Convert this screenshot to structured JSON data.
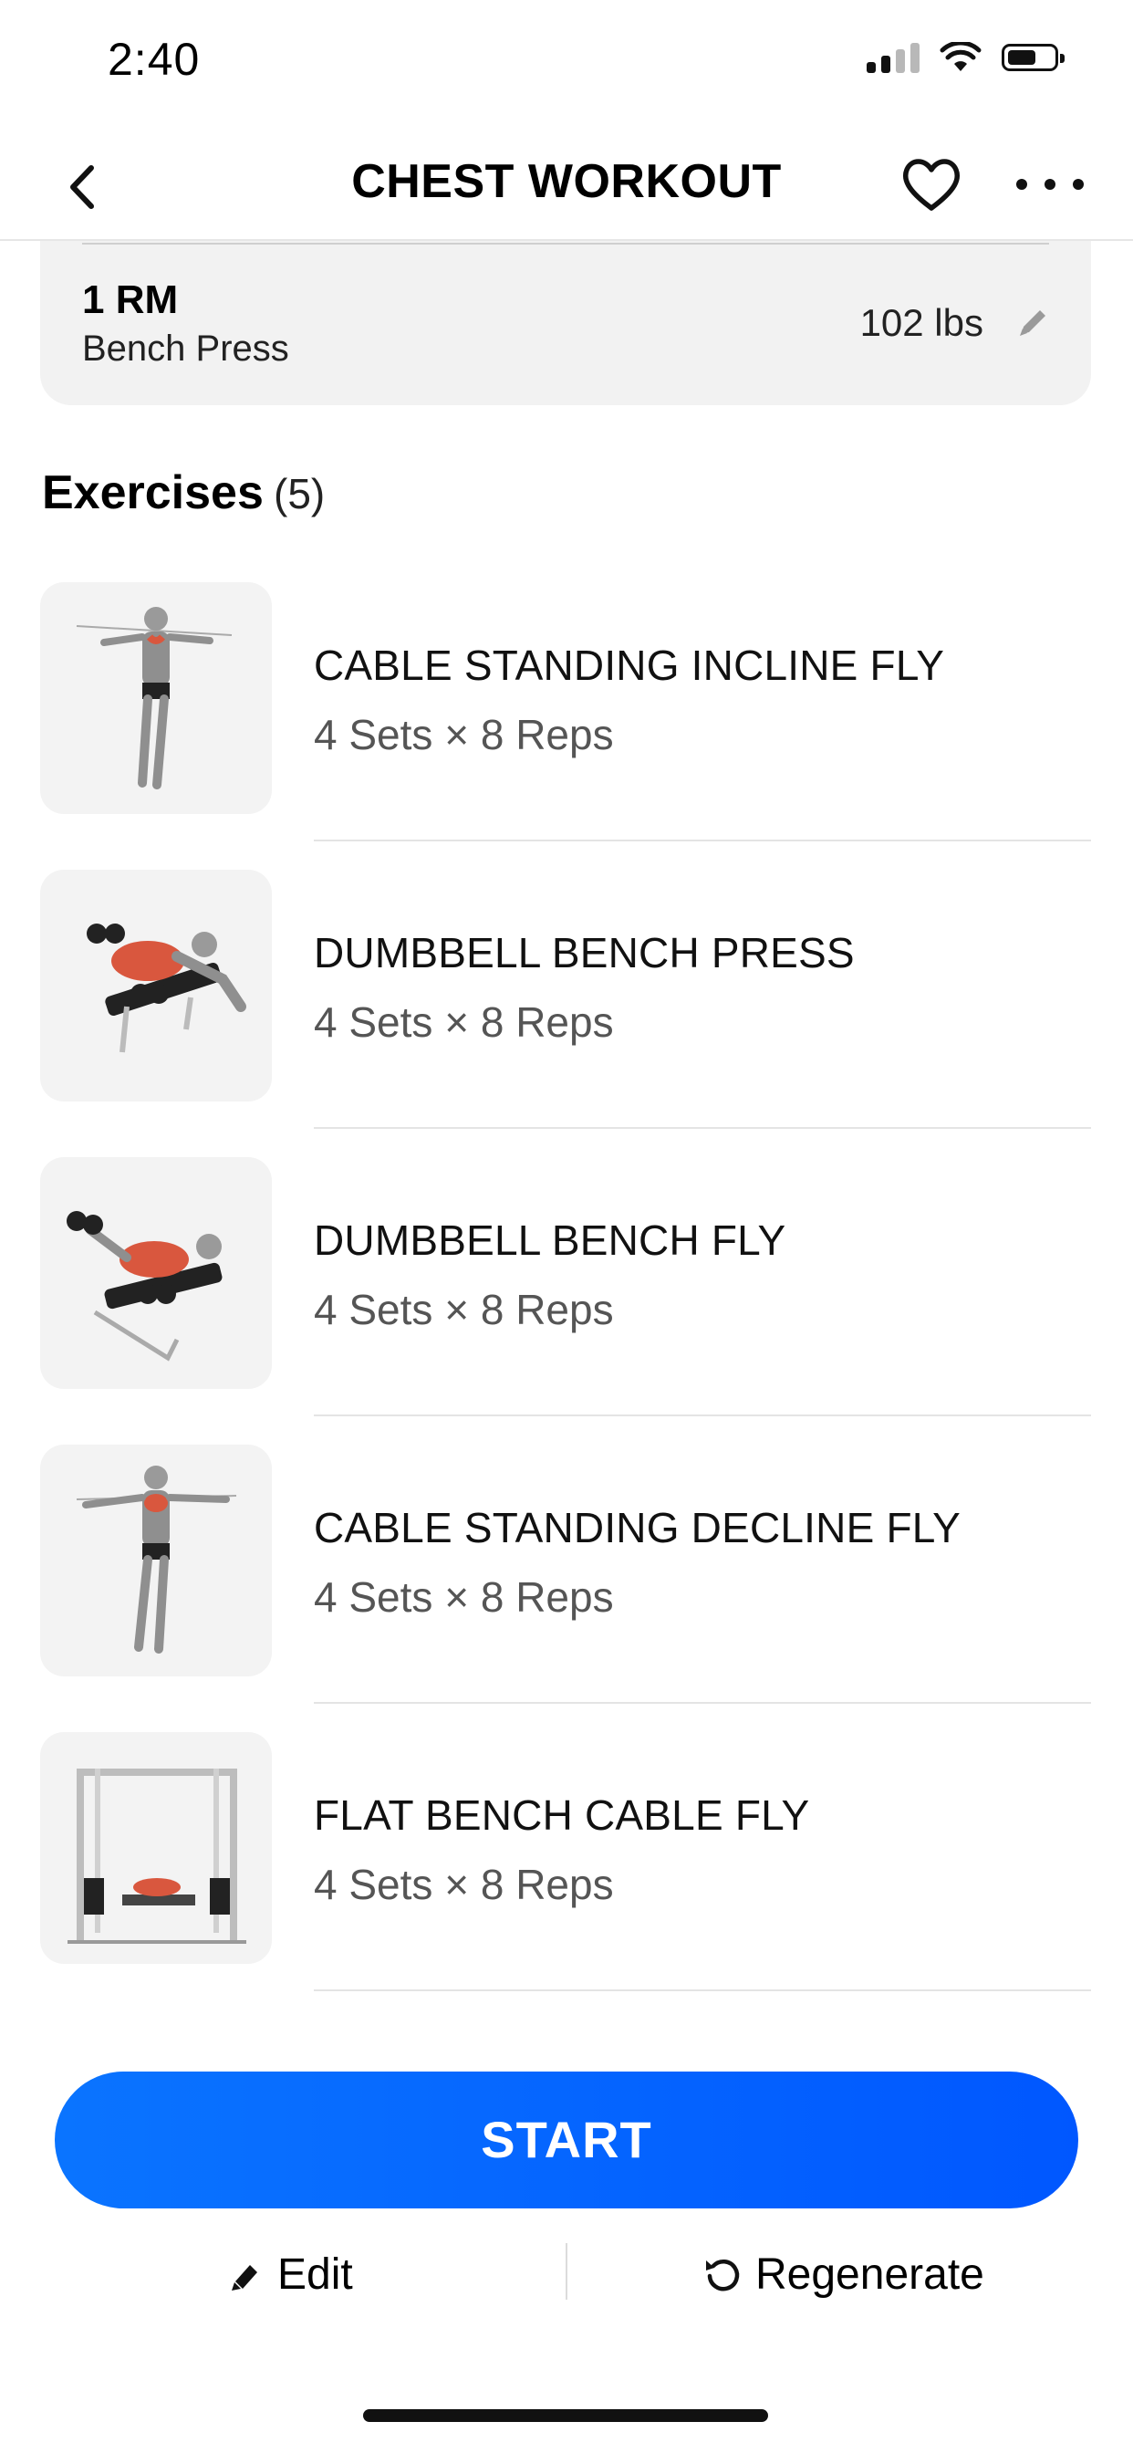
{
  "status_bar": {
    "time": "2:40"
  },
  "nav": {
    "title": "CHEST WORKOUT"
  },
  "one_rm": {
    "label": "1 RM",
    "exercise": "Bench Press",
    "value": "102 lbs"
  },
  "exercises": {
    "title": "Exercises",
    "count": "(5)",
    "items": [
      {
        "name": "CABLE STANDING INCLINE FLY",
        "meta": "4 Sets × 8 Reps"
      },
      {
        "name": "DUMBBELL BENCH PRESS",
        "meta": "4 Sets × 8 Reps"
      },
      {
        "name": "DUMBBELL BENCH FLY",
        "meta": "4 Sets × 8 Reps"
      },
      {
        "name": "CABLE STANDING DECLINE FLY",
        "meta": "4 Sets × 8 Reps"
      },
      {
        "name": "FLAT BENCH CABLE FLY",
        "meta": "4 Sets × 8 Reps"
      }
    ]
  },
  "actions": {
    "start": "START",
    "edit": "Edit",
    "regenerate": "Regenerate"
  },
  "colors": {
    "accent": "#0a6cff",
    "card_bg": "#f2f2f2",
    "muscle_highlight": "#d9573e"
  }
}
